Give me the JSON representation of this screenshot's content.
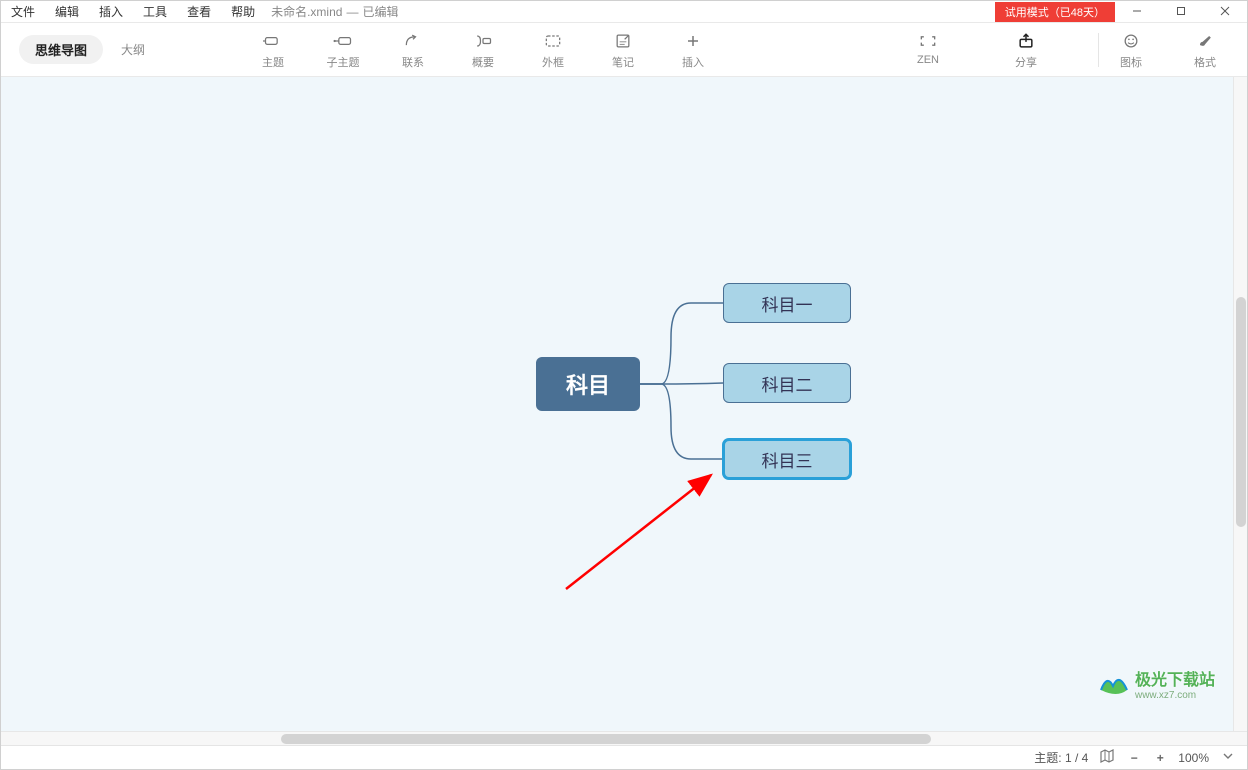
{
  "menu": {
    "file": "文件",
    "edit": "编辑",
    "insert": "插入",
    "tools": "工具",
    "view": "查看",
    "help": "帮助"
  },
  "doc": {
    "name": "未命名.xmind",
    "state": "已编辑"
  },
  "trial": "试用模式（已48天）",
  "view_tabs": {
    "mindmap": "思维导图",
    "outline": "大纲"
  },
  "tools": {
    "topic": "主题",
    "subtopic": "子主题",
    "relation": "联系",
    "summary": "概要",
    "boundary": "外框",
    "note": "笔记",
    "insert": "插入",
    "zen": "ZEN",
    "share": "分享",
    "icons": "图标",
    "format": "格式"
  },
  "mindmap": {
    "central": "科目",
    "children": [
      {
        "label": "科目一",
        "selected": false
      },
      {
        "label": "科目二",
        "selected": false
      },
      {
        "label": "科目三",
        "selected": true
      }
    ]
  },
  "status": {
    "topics_label": "主题: ",
    "topics_value": "1 / 4",
    "zoom": "100%"
  },
  "watermark": {
    "name": "极光下载站",
    "url": "www.xz7.com"
  }
}
